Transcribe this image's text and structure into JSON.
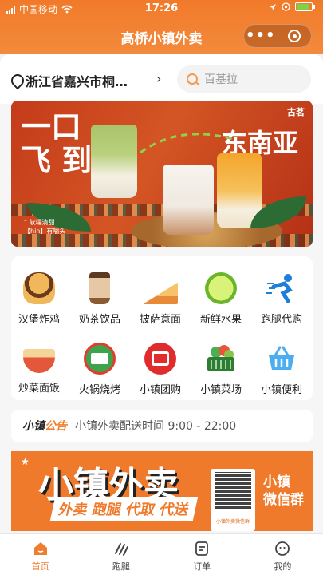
{
  "status_bar": {
    "carrier": "中国移动",
    "time": "17:26"
  },
  "header": {
    "title": "高桥小镇外卖",
    "more_label": "•••"
  },
  "location": {
    "text": "浙江省嘉兴市桐…",
    "arrow": "›"
  },
  "search": {
    "placeholder": "百基拉"
  },
  "banner": {
    "headline_left": "一口\n飞 到",
    "headline_right": "东南亚",
    "logo": "古茗",
    "bottom_text": "“ 软糯清甜\n【hin】有嚼头"
  },
  "categories": [
    {
      "label": "汉堡炸鸡",
      "icon": "burger-icon",
      "color": "#e8a14a"
    },
    {
      "label": "奶茶饮品",
      "icon": "milk-tea-icon",
      "color": "#c89a6a"
    },
    {
      "label": "披萨意面",
      "icon": "pizza-icon",
      "color": "#f2c86a"
    },
    {
      "label": "新鲜水果",
      "icon": "lime-icon",
      "color": "#8bcf3a"
    },
    {
      "label": "跑腿代购",
      "icon": "runner-icon",
      "color": "#2a8de0"
    },
    {
      "label": "炒菜面饭",
      "icon": "noodle-bowl-icon",
      "color": "#e4573a"
    },
    {
      "label": "火锅烧烤",
      "icon": "hotpot-badge-icon",
      "color": "#3fa34d"
    },
    {
      "label": "小镇团购",
      "icon": "group-buy-icon",
      "color": "#e02c2c"
    },
    {
      "label": "小镇菜场",
      "icon": "vegetable-basket-icon",
      "color": "#3a9a4a"
    },
    {
      "label": "小镇便利",
      "icon": "shopping-basket-icon",
      "color": "#4aaef0"
    }
  ],
  "notice": {
    "tag_a": "小镇",
    "tag_b": "公告",
    "text": "小镇外卖配送时间 9:00 - 22:00"
  },
  "promo": {
    "title": "小镇外卖",
    "subtitle": "外卖 跑腿 代取 代送",
    "side_line1": "小镇",
    "side_line2": "微信群",
    "qr_caption": "小镇外卖微信群"
  },
  "tabbar": [
    {
      "label": "首页",
      "active": true
    },
    {
      "label": "跑腿",
      "active": false
    },
    {
      "label": "订单",
      "active": false
    },
    {
      "label": "我的",
      "active": false
    }
  ],
  "colors": {
    "accent": "#f07d2b"
  }
}
